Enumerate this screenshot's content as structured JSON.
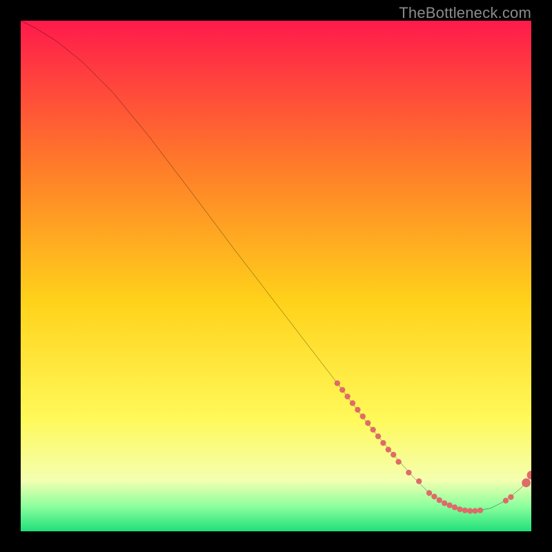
{
  "watermark": "TheBottleneck.com",
  "colors": {
    "background": "#000000",
    "gradient_top": "#ff1a4b",
    "gradient_mid_upper": "#ff7a2a",
    "gradient_mid": "#ffd21a",
    "gradient_mid_lower": "#fff95a",
    "gradient_pale": "#f4ffb0",
    "gradient_green_light": "#8eff9e",
    "gradient_green": "#1fe07a",
    "curve": "#000000",
    "marker_fill": "#e06a6a",
    "marker_stroke": "#b54848"
  },
  "chart_data": {
    "type": "line",
    "title": "",
    "xlabel": "",
    "ylabel": "",
    "xlim": [
      0,
      100
    ],
    "ylim": [
      0,
      100
    ],
    "curve": {
      "x": [
        0,
        3,
        7,
        12,
        18,
        25,
        33,
        42,
        52,
        62,
        68,
        73,
        77,
        80,
        83,
        86,
        89,
        92,
        95,
        98,
        100
      ],
      "y": [
        100,
        98.5,
        96,
        92,
        86,
        77.5,
        67,
        55,
        42,
        29,
        21,
        15,
        10.5,
        7.5,
        5.5,
        4.3,
        4,
        4.5,
        6,
        8.5,
        11
      ]
    },
    "markers_small": {
      "x": [
        62,
        63,
        64,
        65,
        66,
        67,
        68,
        69,
        70,
        71,
        72,
        73,
        74,
        76,
        78,
        80,
        81,
        82,
        83,
        84,
        85,
        86,
        87,
        88,
        89,
        90,
        95,
        96
      ],
      "y": [
        29,
        27.7,
        26.4,
        25.1,
        23.8,
        22.5,
        21.2,
        19.9,
        18.6,
        17.3,
        16.0,
        15.0,
        13.6,
        11.5,
        9.8,
        7.5,
        6.8,
        6.1,
        5.5,
        5.1,
        4.7,
        4.3,
        4.1,
        4.0,
        4.0,
        4.1,
        6.0,
        6.7
      ]
    },
    "markers_large": {
      "x": [
        99,
        100
      ],
      "y": [
        9.5,
        11
      ]
    }
  }
}
